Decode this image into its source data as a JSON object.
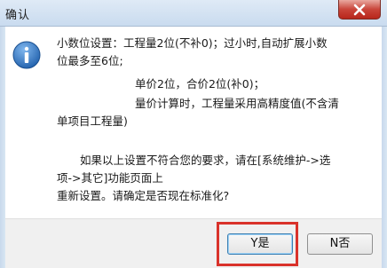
{
  "window": {
    "title": "确认",
    "close_icon": "close-icon"
  },
  "dialog": {
    "icon": "info-icon",
    "lines": [
      "小数位设置：工程量2位(不补0)；过小时,自动扩展小数",
      "位最多至6位;",
      "单价2位，合价2位(补0)；",
      "量价计算时，工程量采用高精度值(不含清",
      "单项目工程量)",
      "如果以上设置不符合您的要求，请在[系统维护->选",
      "项->其它]功能页面上",
      "重新设置。请确定是否现在标准化?"
    ]
  },
  "buttons": {
    "yes_label": "Y是",
    "no_label": "N否"
  },
  "colors": {
    "highlight": "#d9322b",
    "info_icon": "#2d6fb8"
  }
}
